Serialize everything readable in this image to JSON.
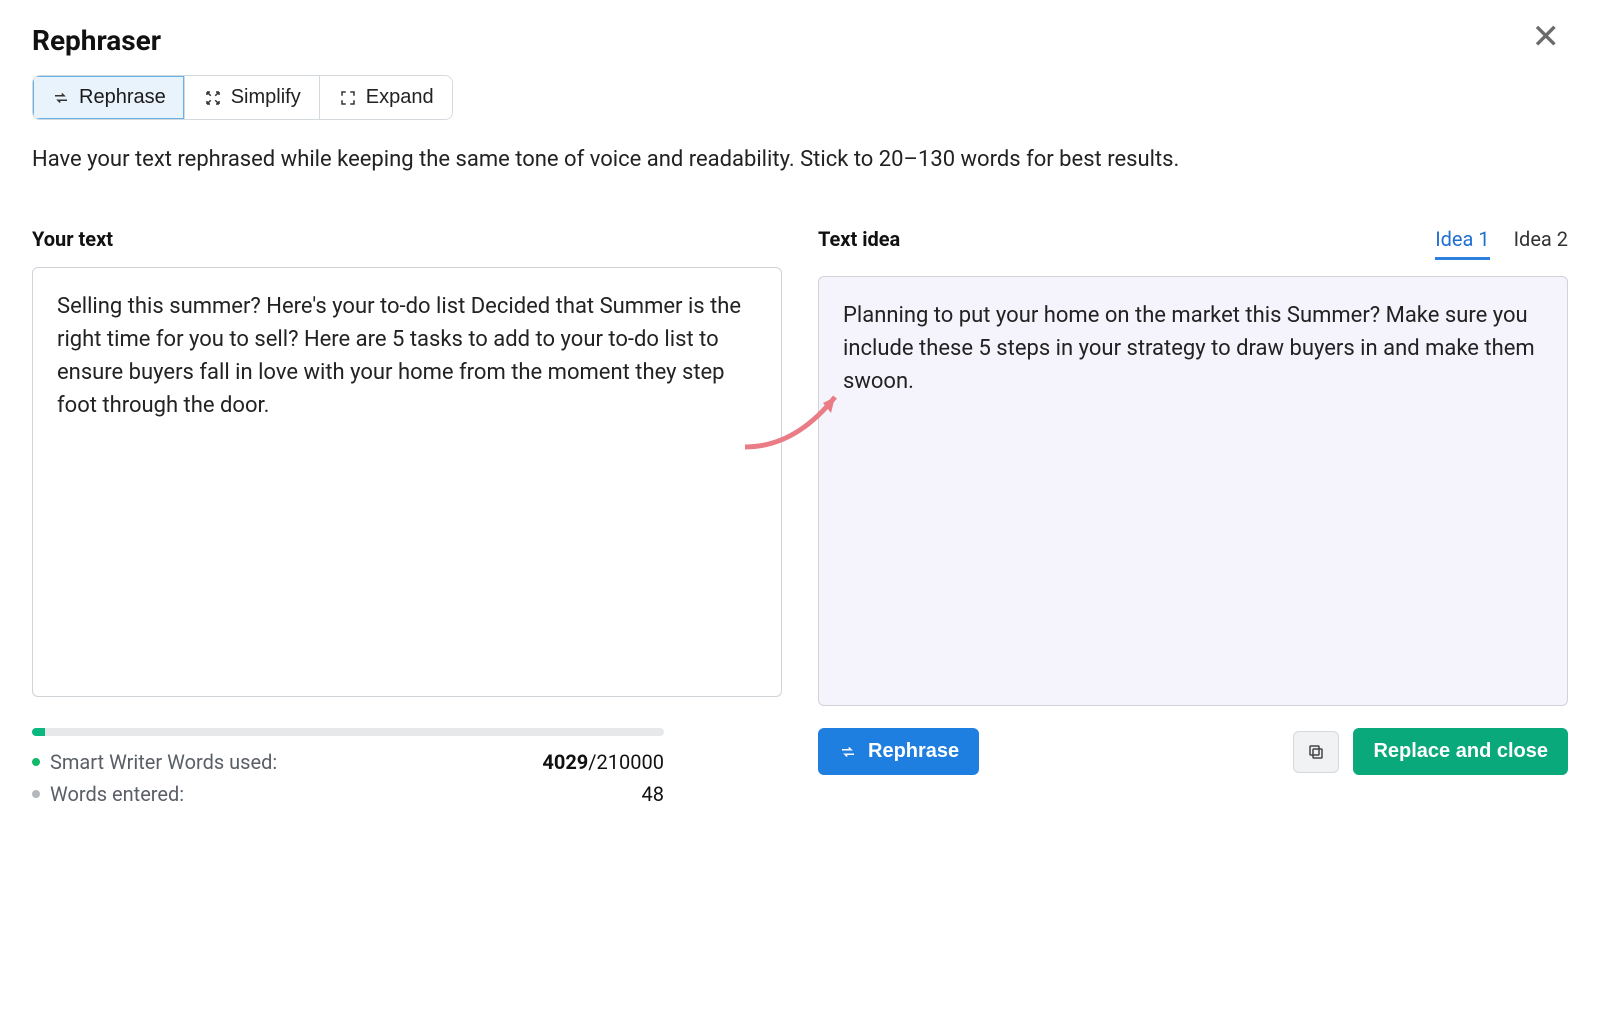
{
  "title": "Rephraser",
  "tabs": {
    "rephrase": "Rephrase",
    "simplify": "Simplify",
    "expand": "Expand"
  },
  "description": "Have your text rephrased while keeping the same tone of voice and readability. Stick to 20–130 words for best results.",
  "left": {
    "label": "Your text",
    "text": "Selling this summer? Here's your to-do list Decided that Summer is the right time for you to sell? Here are 5 tasks to add to your to-do list to ensure buyers fall in love with your home from the moment they step foot through the door."
  },
  "right": {
    "label": "Text idea",
    "ideaTabs": {
      "idea1": "Idea 1",
      "idea2": "Idea 2"
    },
    "text": "Planning to put your home on the market this Summer? Make sure you include these 5 steps in your strategy to draw buyers in and make them swoon."
  },
  "meters": {
    "smartLabel": "Smart Writer Words used:",
    "smartUsed": "4029",
    "smartSep": "/",
    "smartTotal": "210000",
    "wordsEnteredLabel": "Words entered:",
    "wordsEntered": "48"
  },
  "buttons": {
    "rephrase": "Rephrase",
    "replaceClose": "Replace and close"
  }
}
